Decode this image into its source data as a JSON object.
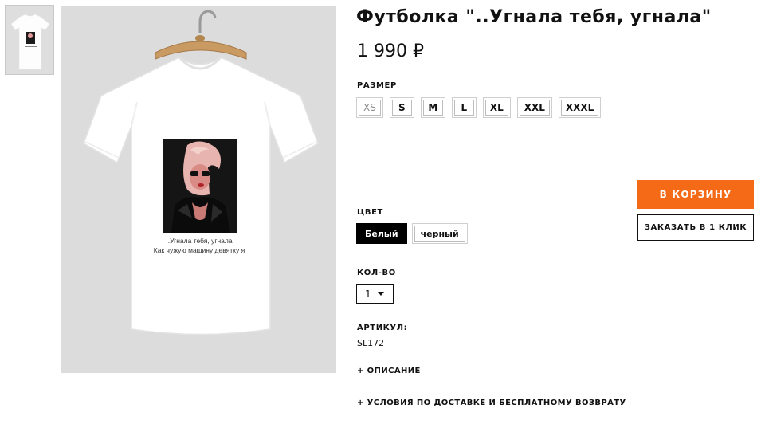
{
  "gallery": {
    "main_caption": [
      "..Угнала тебя, угнала",
      "Как чужую машину девятку я"
    ]
  },
  "product": {
    "title": "Футболка \"..Угнала тебя, угнала\"",
    "price": "1 990 ₽",
    "size_label": "РАЗМЕР",
    "sizes": [
      "XS",
      "S",
      "M",
      "L",
      "XL",
      "XXL",
      "XXXL"
    ],
    "color_label": "ЦВЕТ",
    "colors": [
      "Белый",
      "черный"
    ],
    "qty_label": "КОЛ-ВО",
    "qty_value": "1",
    "sku_label": "АРТИКУЛ:",
    "sku_value": "SL172",
    "description_toggle": "+ ОПИСАНИЕ",
    "delivery_toggle": "+ УСЛОВИЯ ПО ДОСТАВКЕ И БЕСПЛАТНОМУ ВОЗВРАТУ"
  },
  "actions": {
    "add_to_cart": "В КОРЗИНУ",
    "one_click": "ЗАКАЗАТЬ В 1 КЛИК",
    "accent_color": "#f56a17"
  }
}
